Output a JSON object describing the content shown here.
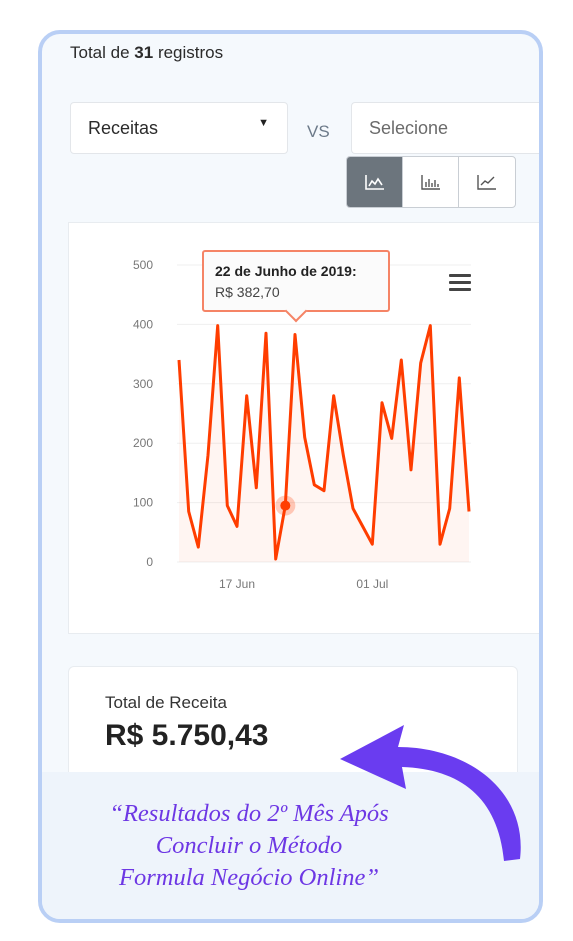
{
  "summary": {
    "prefix": "Total de",
    "count": "31",
    "suffix": "registros"
  },
  "filters": {
    "primary_value": "Receitas",
    "vs_label": "VS",
    "secondary_placeholder": "Selecione"
  },
  "chart_type_buttons": [
    {
      "icon": "area-chart-icon",
      "active": true
    },
    {
      "icon": "bar-chart-icon",
      "active": false
    },
    {
      "icon": "line-chart-icon",
      "active": false
    }
  ],
  "tooltip": {
    "date": "22 de Junho de 2019:",
    "value": "R$ 382,70"
  },
  "chart_data": {
    "type": "area",
    "ylim": [
      0,
      500
    ],
    "yticks": [
      "0",
      "100",
      "200",
      "300",
      "400",
      "500"
    ],
    "xticks": [
      "17 Jun",
      "01 Jul"
    ],
    "x_start": "2019-06-11",
    "x_end": "2019-07-11",
    "highlight_index": 11,
    "series": [
      {
        "color": "#ff3d00",
        "values": [
          340,
          85,
          25,
          180,
          398,
          95,
          60,
          280,
          125,
          385,
          5,
          95,
          383,
          210,
          130,
          120,
          280,
          180,
          90,
          60,
          30,
          268,
          208,
          340,
          155,
          335,
          398,
          30,
          90,
          310,
          85
        ]
      }
    ]
  },
  "revenue": {
    "caption": "Total de Receita",
    "amount": "R$ 5.750,43"
  },
  "caption": {
    "line1": "“Resultados do 2º Mês Após",
    "line2": "Concluir o Método",
    "line3": "Formula Negócio Online”"
  },
  "colors": {
    "frame_border": "#b9cff5",
    "series_line": "#ff3d00",
    "caption_text": "#6d37e4",
    "arrow": "#6a3cf0"
  }
}
